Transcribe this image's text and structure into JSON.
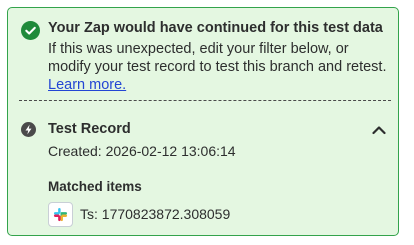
{
  "alert": {
    "title": "Your Zap would have continued for this test data",
    "body": "If this was unexpected, edit your filter below, or modify your test record to test this branch and retest. ",
    "link": "Learn more.",
    "icon": "check-circle-icon",
    "color": "#33a34b"
  },
  "record": {
    "title": "Test Record",
    "icon": "lightning-bolt-icon",
    "created": "Created: 2026-02-12 13:06:14",
    "toggle_icon": "chevron-up-icon"
  },
  "matched": {
    "label": "Matched items",
    "items": [
      {
        "app_icon": "slack-logo-icon",
        "text": "Ts: 1770823872.308059"
      }
    ]
  }
}
